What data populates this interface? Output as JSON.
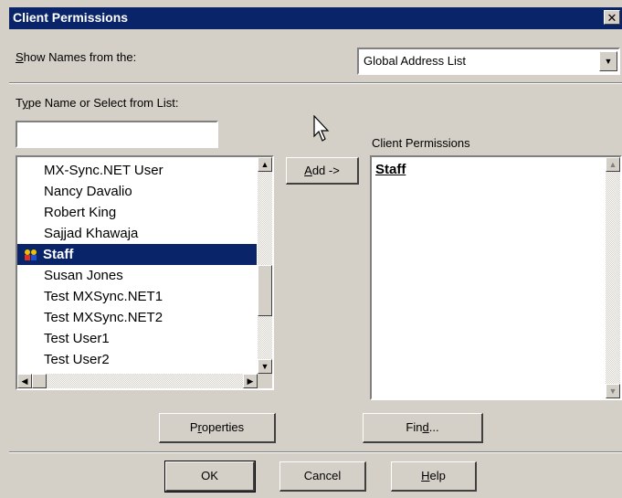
{
  "dialog": {
    "title": "Client Permissions",
    "close_glyph": "✕"
  },
  "show_names": {
    "label_mnemonic": "S",
    "label_rest": "how Names from the:",
    "selected": "Global Address List"
  },
  "type_name": {
    "label_pre": "T",
    "label_mnemonic": "y",
    "label_rest": "pe Name or Select from List:",
    "value": ""
  },
  "names_list": {
    "items": [
      "MX-Sync.NET User",
      "Nancy Davalio",
      "Robert King",
      "Sajjad Khawaja",
      "Staff",
      "Susan Jones",
      "Test MXSync.NET1",
      "Test MXSync.NET2",
      "Test User1",
      "Test User2"
    ],
    "selected_index": 4
  },
  "add_button": {
    "mnemonic": "A",
    "rest": "dd ->"
  },
  "client_permissions": {
    "label": "Client Permissions",
    "items": [
      "Staff"
    ]
  },
  "buttons": {
    "properties_pre": "P",
    "properties_mnemonic": "r",
    "properties_rest": "operties",
    "find_pre": "Fin",
    "find_mnemonic": "d",
    "find_rest": "...",
    "ok": "OK",
    "cancel": "Cancel",
    "help_mnemonic": "H",
    "help_rest": "elp"
  },
  "glyphs": {
    "up": "▲",
    "down": "▼",
    "left": "◀",
    "right": "▶"
  },
  "icons": {
    "group": "distribution-group-icon",
    "cursor": "mouse-pointer-icon"
  }
}
